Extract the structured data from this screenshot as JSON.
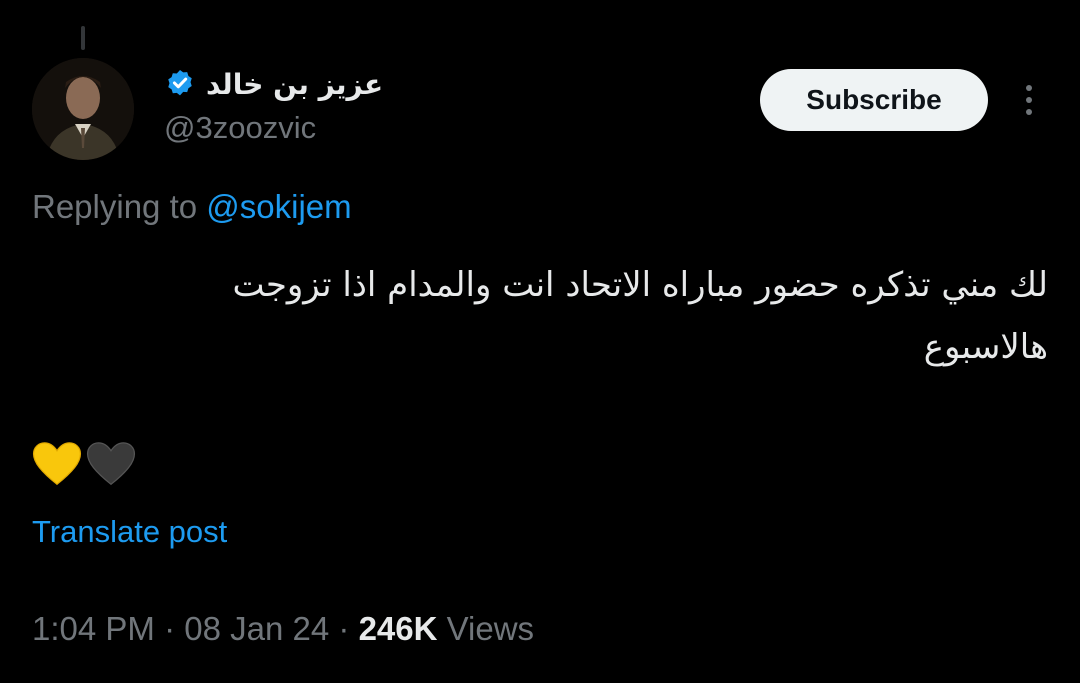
{
  "author": {
    "display_name": "عزيز بن خالد",
    "handle": "@3zoozvic",
    "verified": true,
    "avatar_icon": "profile-photo"
  },
  "actions": {
    "subscribe_label": "Subscribe",
    "more_icon": "more-vertical-icon"
  },
  "reply": {
    "prefix": "Replying to",
    "mention": "@sokijem"
  },
  "post": {
    "text": "لك مني تذكره حضور مباراه الاتحاد انت والمدام اذا تزوجت هالاسبوع",
    "emojis": [
      "yellow-heart",
      "black-heart"
    ]
  },
  "translate_label": "Translate post",
  "meta": {
    "time": "1:04 PM",
    "date": "08 Jan 24",
    "views_count": "246K",
    "views_label": "Views"
  },
  "colors": {
    "background": "#000000",
    "text": "#e7e9ea",
    "secondary": "#71767b",
    "link": "#1d9bf0",
    "button_bg": "#eff3f4"
  }
}
